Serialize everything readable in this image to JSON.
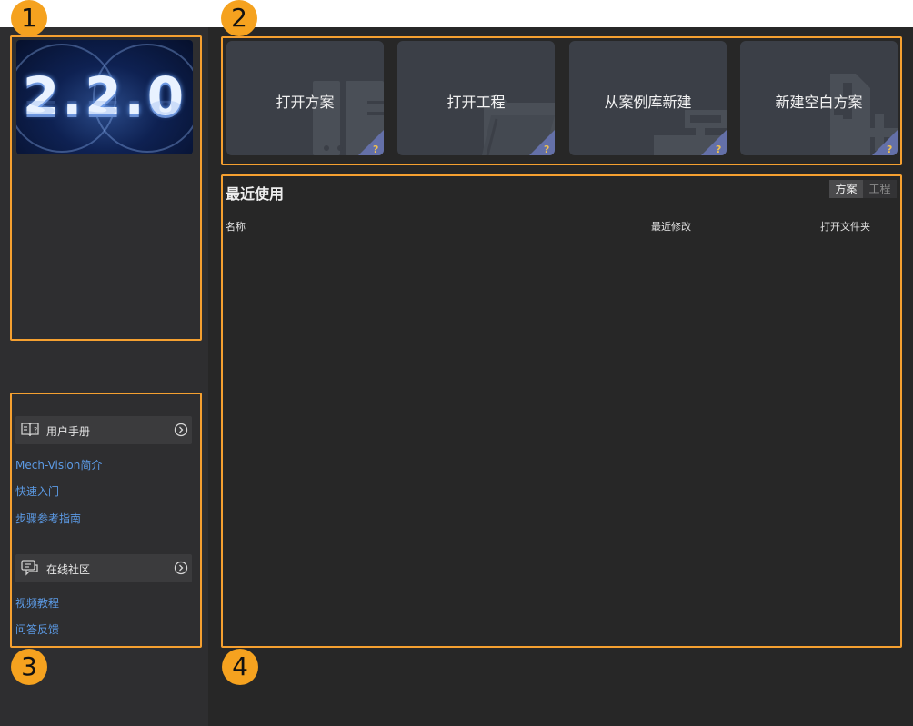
{
  "badges": [
    "1",
    "2",
    "3",
    "4"
  ],
  "logo": {
    "version": "2.2.0"
  },
  "help": {
    "manual": {
      "title": "用户手册",
      "links": [
        "Mech-Vision简介",
        "快速入门",
        "步骤参考指南"
      ]
    },
    "community": {
      "title": "在线社区",
      "links": [
        "视频教程",
        "问答反馈"
      ]
    }
  },
  "actions": [
    {
      "label": "打开方案",
      "icon": "cabinet-icon"
    },
    {
      "label": "打开工程",
      "icon": "folder-icon"
    },
    {
      "label": "从案例库新建",
      "icon": "library-icon"
    },
    {
      "label": "新建空白方案",
      "icon": "add-document-icon"
    }
  ],
  "recent": {
    "title": "最近使用",
    "tabs": [
      "方案",
      "工程"
    ],
    "active_tab": "方案",
    "columns": [
      "名称",
      "最近修改",
      "打开文件夹"
    ]
  },
  "colors": {
    "highlight": "#f5a030",
    "link": "#5c9be6",
    "card": "#3b3f47",
    "sidebar": "#2e2e30",
    "main": "#272727"
  }
}
